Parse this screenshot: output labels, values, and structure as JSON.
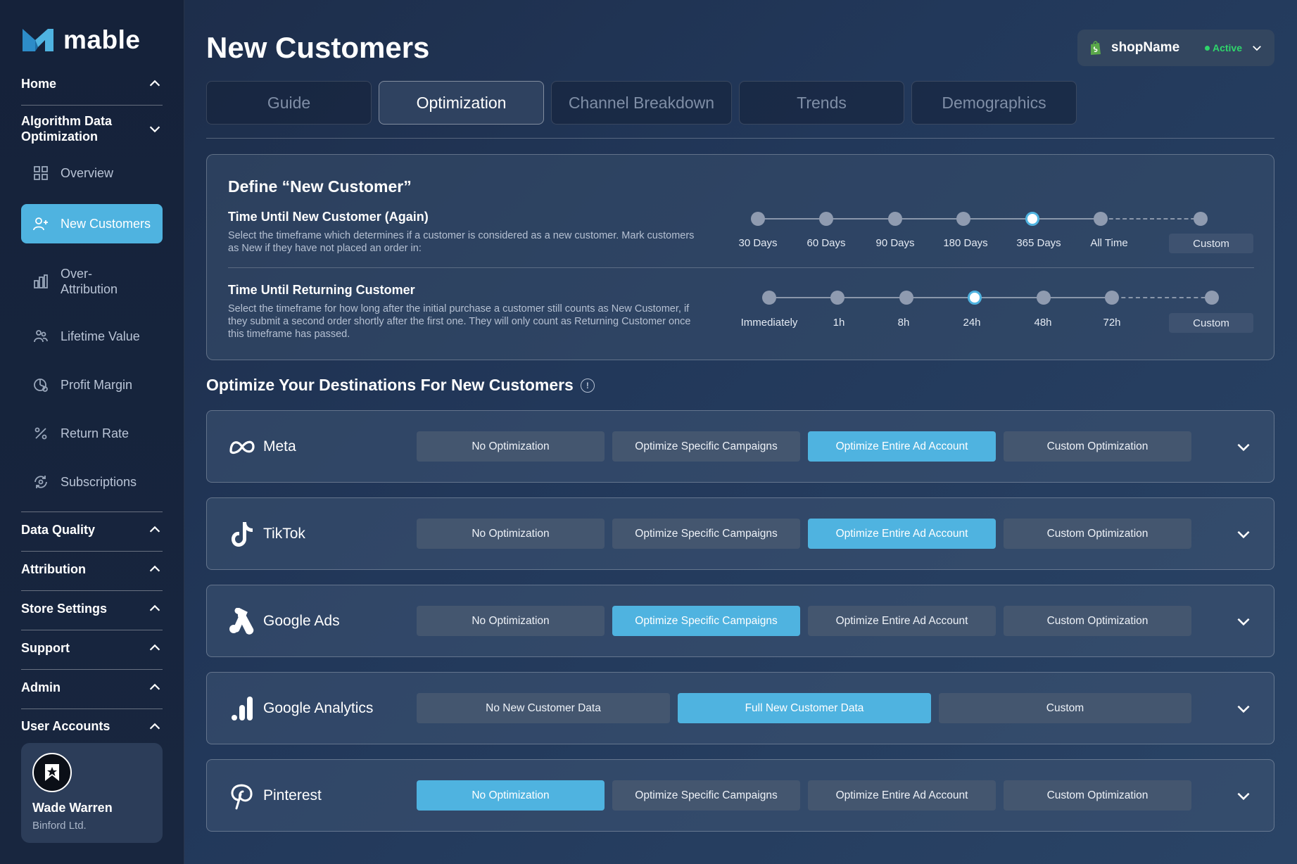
{
  "app": {
    "brand": "mable"
  },
  "sidebar": {
    "sections": [
      {
        "label": "Home",
        "state": "expanded"
      },
      {
        "label": "Algorithm Data\nOptimization",
        "state": "collapsed"
      },
      {
        "label": "Data Quality",
        "state": "expanded"
      },
      {
        "label": "Attribution",
        "state": "expanded"
      },
      {
        "label": "Store Settings",
        "state": "expanded"
      },
      {
        "label": "Support",
        "state": "expanded"
      },
      {
        "label": "Admin",
        "state": "expanded"
      },
      {
        "label": "User Accounts",
        "state": "expanded"
      }
    ],
    "items": [
      {
        "label": "Overview",
        "icon": "grid-icon"
      },
      {
        "label": "New Customers",
        "icon": "user-plus-icon",
        "active": true
      },
      {
        "label": "Over-\nAttribution",
        "icon": "bar-chart-icon"
      },
      {
        "label": "Lifetime Value",
        "icon": "people-icon"
      },
      {
        "label": "Profit Margin",
        "icon": "pie-clock-icon"
      },
      {
        "label": "Return Rate",
        "icon": "percent-icon"
      },
      {
        "label": "Subscriptions",
        "icon": "refresh-icon"
      }
    ],
    "user": {
      "name": "Wade Warren",
      "company": "Binford Ltd."
    }
  },
  "header": {
    "title": "New Customers",
    "shop": {
      "name": "shopName",
      "status": "Active"
    }
  },
  "tabs": [
    "Guide",
    "Optimization",
    "Channel Breakdown",
    "Trends",
    "Demographics"
  ],
  "active_tab": "Optimization",
  "define": {
    "title": "Define “New Customer”",
    "rows": [
      {
        "title": "Time Until New Customer (Again)",
        "description": "Select the timeframe which determines if a customer is considered as a new customer. Mark customers as New if they have not placed an order in:",
        "options": [
          "30 Days",
          "60 Days",
          "90 Days",
          "180 Days",
          "365 Days",
          "All Time"
        ],
        "custom_label": "Custom",
        "selected": "365 Days"
      },
      {
        "title": "Time Until Returning Customer",
        "description": "Select the timeframe for how long after the initial purchase a customer still counts as New Customer, if they submit a second order shortly after the first one. They will only count as Returning Customer once this timeframe has passed.",
        "options": [
          "Immediately",
          "1h",
          "8h",
          "24h",
          "48h",
          "72h"
        ],
        "custom_label": "Custom",
        "selected": "24h"
      }
    ]
  },
  "destinations": {
    "title": "Optimize Your Destinations For New Customers",
    "items": [
      {
        "name": "Meta",
        "icon": "meta-icon",
        "options": [
          "No Optimization",
          "Optimize Specific Campaigns",
          "Optimize Entire Ad Account",
          "Custom Optimization"
        ],
        "selected": "Optimize Entire Ad Account"
      },
      {
        "name": "TikTok",
        "icon": "tiktok-icon",
        "options": [
          "No Optimization",
          "Optimize Specific Campaigns",
          "Optimize Entire Ad Account",
          "Custom Optimization"
        ],
        "selected": "Optimize Entire Ad Account"
      },
      {
        "name": "Google Ads",
        "icon": "google-ads-icon",
        "options": [
          "No Optimization",
          "Optimize Specific Campaigns",
          "Optimize Entire Ad Account",
          "Custom Optimization"
        ],
        "selected": "Optimize Specific Campaigns"
      },
      {
        "name": "Google Analytics",
        "icon": "google-analytics-icon",
        "options": [
          "No New Customer Data",
          "Full New Customer Data",
          "Custom"
        ],
        "selected": "Full New Customer Data"
      },
      {
        "name": "Pinterest",
        "icon": "pinterest-icon",
        "options": [
          "No Optimization",
          "Optimize Specific Campaigns",
          "Optimize Entire Ad Account",
          "Custom Optimization"
        ],
        "selected": "No Optimization"
      }
    ]
  },
  "colors": {
    "accent": "#4fb3e0",
    "active_status": "#2fd56b",
    "background": "#1c2b47"
  }
}
